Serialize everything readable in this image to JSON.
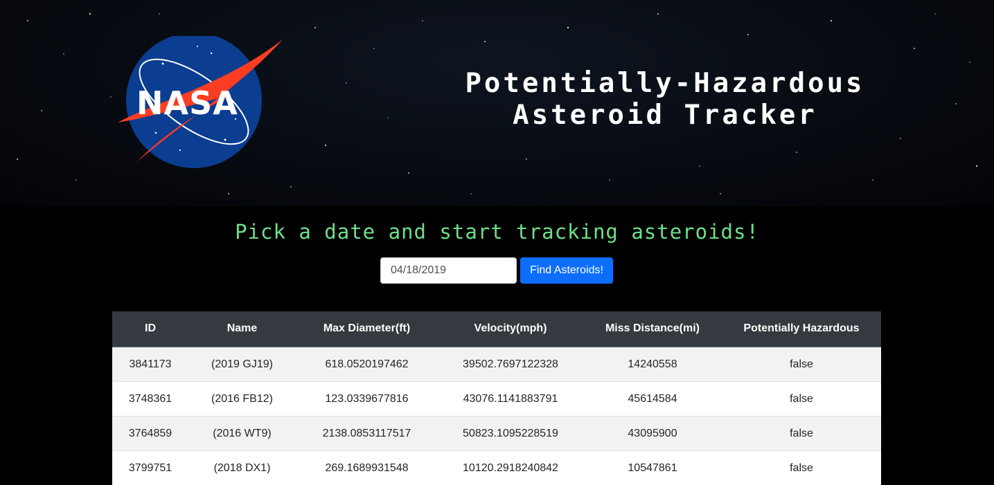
{
  "header": {
    "logo_text": "NASA",
    "title_line1": "Potentially-Hazardous",
    "title_line2": "Asteroid Tracker"
  },
  "tagline": "Pick a date and start tracking asteroids!",
  "search": {
    "date_value": "04/18/2019",
    "button_label": "Find Asteroids!"
  },
  "colors": {
    "accent": "#0d6efd",
    "tagline": "#6ee08a",
    "table_header": "#343a40",
    "nasa_blue": "#0b3d91",
    "nasa_red": "#fc3d21"
  },
  "table": {
    "columns": [
      "ID",
      "Name",
      "Max Diameter(ft)",
      "Velocity(mph)",
      "Miss Distance(mi)",
      "Potentially Hazardous"
    ],
    "rows": [
      [
        "3841173",
        "(2019 GJ19)",
        "618.0520197462",
        "39502.7697122328",
        "14240558",
        "false"
      ],
      [
        "3748361",
        "(2016 FB12)",
        "123.0339677816",
        "43076.1141883791",
        "45614584",
        "false"
      ],
      [
        "3764859",
        "(2016 WT9)",
        "2138.0853117517",
        "50823.1095228519",
        "43095900",
        "false"
      ],
      [
        "3799751",
        "(2018 DX1)",
        "269.1689931548",
        "10120.2918240842",
        "10547861",
        "false"
      ]
    ]
  }
}
